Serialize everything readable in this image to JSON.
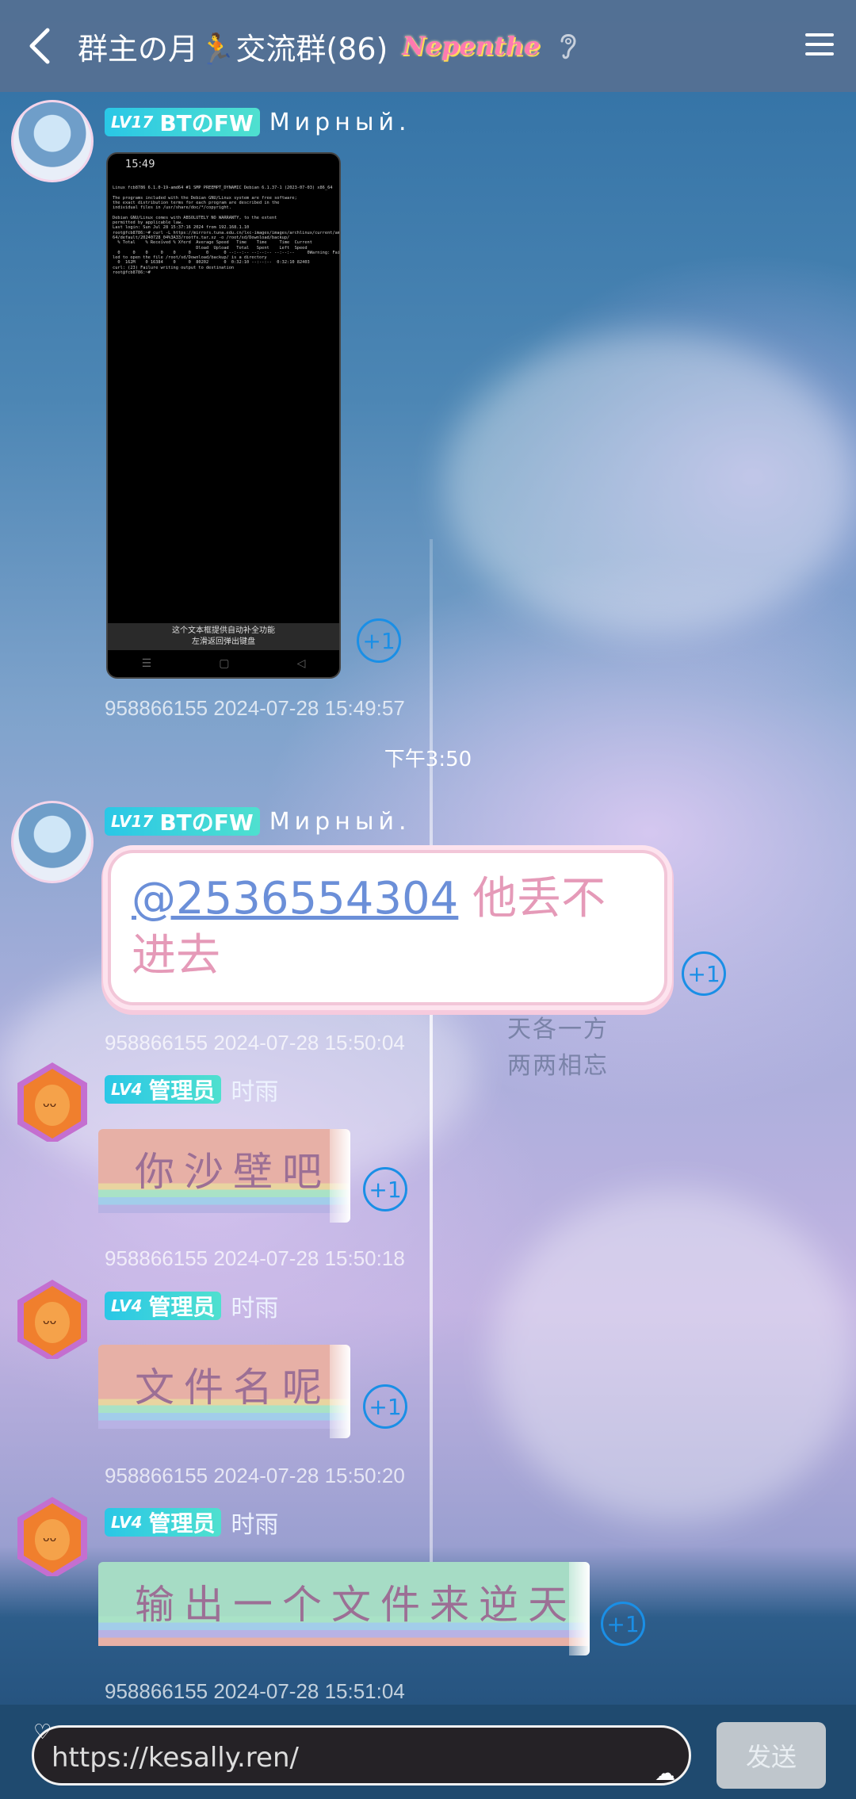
{
  "header": {
    "chat_title": "群主の月🏃交流群(86)",
    "brand_tag": "Nepenthe"
  },
  "messages": [
    {
      "sender_level": "LV17",
      "sender_title": "BTのFW",
      "sender_name": "Мирный.",
      "image": {
        "status_time": "15:49",
        "terminal_text": "Linux fcb8786 6.1.0-19-amd64 #1 SMP PREEMPT_DYNAMIC Debian 6.1.37-1 (2023-07-03) x86_64\n\nThe programs included with the Debian GNU/Linux system are free software;\nthe exact distribution terms for each program are described in the\nindividual files in /usr/share/doc/*/copyright.\n\nDebian GNU/Linux comes with ABSOLUTELY NO WARRANTY, to the extent\npermitted by applicable law.\nLast login: Sun Jul 28 15:37:16 2024 from 192.168.1.10\nroot@fcb8786:~# curl -L https://mirrors.tuna.edu.cn/lxc-images/images/archlinux/current/amd\n64/default/20240728_04%3A33/rootfs.tar.xz -o /root/sd/Download/backup/\n  % Total    % Received % Xferd  Average Speed   Time    Time     Time  Current\n                                 Dload  Upload   Total   Spent    Left  Speed\n  0     0    0     0    0     0      0      0 --:--:-- --:--:-- --:--:--     0Warning: Fai\nled to open the file /root/sd/Download/backup/ is a directory\n  0  162M    0 16384    0     0  80202      0  0:32:10 --:--:--  0:32:10 82403\ncurl: (23) Failure writing output to destination\nroot@fcb8786:~# ",
        "footer_line1": "这个文本框提供自动补全功能",
        "footer_line2": "左滑返回弹出键盘"
      },
      "plus_label": "+1",
      "meta": "958866155 2024-07-28 15:49:57"
    },
    {
      "sender_level": "LV17",
      "sender_title": "BTのFW",
      "sender_name": "Мирный.",
      "mention": "@2536554304",
      "text": " 他丢不进去",
      "plus_label": "+1",
      "meta": "958866155 2024-07-28 15:50:04"
    },
    {
      "sender_level": "LV4",
      "sender_title": "管理员",
      "sender_name": "时雨",
      "text": "你沙壁吧",
      "plus_label": "+1",
      "meta": "958866155 2024-07-28 15:50:18"
    },
    {
      "sender_level": "LV4",
      "sender_title": "管理员",
      "sender_name": "时雨",
      "text": "文件名呢",
      "plus_label": "+1",
      "meta": "958866155 2024-07-28 15:50:20"
    },
    {
      "sender_level": "LV4",
      "sender_title": "管理员",
      "sender_name": "时雨",
      "text": "输出一个文件来逆天",
      "plus_label": "+1",
      "meta": "958866155 2024-07-28 15:51:04"
    }
  ],
  "time_divider": "下午3:50",
  "watermark": {
    "line1": "天各一方",
    "line2": "两两相忘"
  },
  "composer": {
    "input_value": "https://kesally.ren/",
    "send_label": "发送"
  },
  "colors": {
    "header_bg": "#567092",
    "plus_accent": "#1a8fe6",
    "badge": "#2ac7e6",
    "send_disabled": "#bfc6cc"
  },
  "icons": [
    "back-icon",
    "ear-icon",
    "menu-icon"
  ]
}
